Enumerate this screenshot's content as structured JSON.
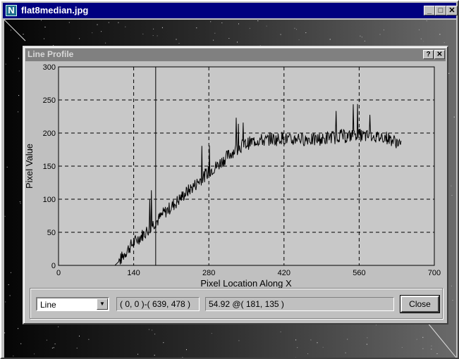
{
  "outer_window": {
    "title": "flat8median.jpg",
    "app_icon_letter": "N",
    "minimize_glyph": "_",
    "maximize_glyph": "□",
    "close_glyph": "✕"
  },
  "dialog": {
    "title": "Line Profile",
    "help_glyph": "?",
    "close_glyph": "✕"
  },
  "chart_data": {
    "type": "line",
    "xlabel": "Pixel Location Along X",
    "ylabel": "Pixel Value",
    "xlim": [
      0,
      700
    ],
    "ylim": [
      0,
      300
    ],
    "xticks": [
      0,
      140,
      280,
      420,
      560,
      700
    ],
    "yticks": [
      0,
      50,
      100,
      150,
      200,
      250,
      300
    ],
    "grid": true,
    "cursor_x": 181,
    "series": [
      {
        "x": [
          105,
          115,
          125,
          135,
          145,
          155,
          165,
          175,
          185,
          195,
          205,
          215,
          225,
          235,
          245,
          255,
          265,
          275,
          285,
          295,
          305,
          315,
          325,
          335,
          345,
          355,
          365,
          375,
          385,
          395,
          405,
          415,
          425,
          435,
          445,
          455,
          465,
          475,
          485,
          495,
          505,
          515,
          525,
          535,
          545,
          555,
          565,
          575,
          585,
          595,
          605,
          615,
          625,
          635,
          639
        ],
        "values": [
          0,
          8,
          20,
          30,
          38,
          45,
          52,
          62,
          68,
          78,
          85,
          92,
          100,
          108,
          115,
          122,
          130,
          138,
          145,
          150,
          158,
          165,
          172,
          178,
          182,
          185,
          188,
          190,
          188,
          192,
          190,
          193,
          191,
          188,
          194,
          190,
          192,
          189,
          191,
          190,
          195,
          193,
          197,
          194,
          196,
          198,
          196,
          195,
          197,
          193,
          195,
          192,
          188,
          185,
          178
        ]
      }
    ]
  },
  "controls": {
    "mode_value": "Line",
    "range_readout": "( 0, 0 )-( 639, 478 )",
    "value_readout": "54.92 @( 181, 135 )",
    "close_label": "Close"
  }
}
